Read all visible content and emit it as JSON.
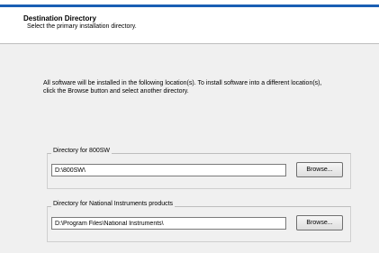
{
  "header": {
    "title": "Destination Directory",
    "subtitle": "Select the primary installation directory."
  },
  "intro_text": "All software will be installed in the following location(s). To install software into a different location(s), click the Browse button and select another directory.",
  "groups": [
    {
      "label": "Directory for 800SW",
      "path": "D:\\800SW\\",
      "browse_label": "Browse..."
    },
    {
      "label": "Directory for National Instruments products",
      "path": "D:\\Program Files\\National Instruments\\",
      "browse_label": "Browse..."
    }
  ],
  "colors": {
    "accent_bar": "#1a5fb4",
    "panel_background": "#f0f0f0"
  }
}
